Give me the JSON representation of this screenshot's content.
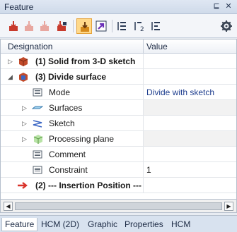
{
  "window": {
    "title": "Feature",
    "pin_label": "⊑",
    "close_label": "✕"
  },
  "toolbar": {
    "buttons": [
      {
        "name": "feature-red-1-icon",
        "active": false
      },
      {
        "name": "feature-red-2-icon",
        "active": false
      },
      {
        "name": "feature-red-3-icon",
        "active": false
      },
      {
        "name": "feature-red-4-icon",
        "active": false
      },
      {
        "name": "feature-yellow-icon",
        "active": true
      },
      {
        "name": "navigate-arrow-icon",
        "active": false
      },
      {
        "name": "sort-1-icon",
        "active": false
      },
      {
        "name": "sort-2-icon",
        "active": false
      },
      {
        "name": "sort-3-icon",
        "active": false
      },
      {
        "name": "gear-icon",
        "active": false
      }
    ]
  },
  "grid": {
    "headers": {
      "designation": "Designation",
      "value": "Value"
    },
    "rows": [
      {
        "label": "(1) Solid from 3-D sketch",
        "value": "",
        "bold": true
      },
      {
        "label": "(3) Divide surface",
        "value": "",
        "bold": true
      },
      {
        "label": "Mode",
        "value": "Divide with sketch"
      },
      {
        "label": "Surfaces",
        "value": ""
      },
      {
        "label": "Sketch",
        "value": ""
      },
      {
        "label": "Processing plane",
        "value": ""
      },
      {
        "label": "Comment",
        "value": ""
      },
      {
        "label": "Constraint",
        "value": "1"
      },
      {
        "label": "(2) --- Insertion Position ---",
        "value": "",
        "bold": true
      }
    ]
  },
  "scroll": {
    "left_label": "◀",
    "right_label": "▶"
  },
  "tabs": [
    {
      "label": "Feature",
      "active": true
    },
    {
      "label": "HCM (2D)",
      "active": false
    },
    {
      "label": "Graphic",
      "active": false
    },
    {
      "label": "Properties",
      "active": false
    },
    {
      "label": "HCM",
      "active": false
    }
  ],
  "colors": {
    "accent": "#ffd98a",
    "value_text": "#1f3f8f",
    "insertion_arrow": "#d9332a"
  }
}
